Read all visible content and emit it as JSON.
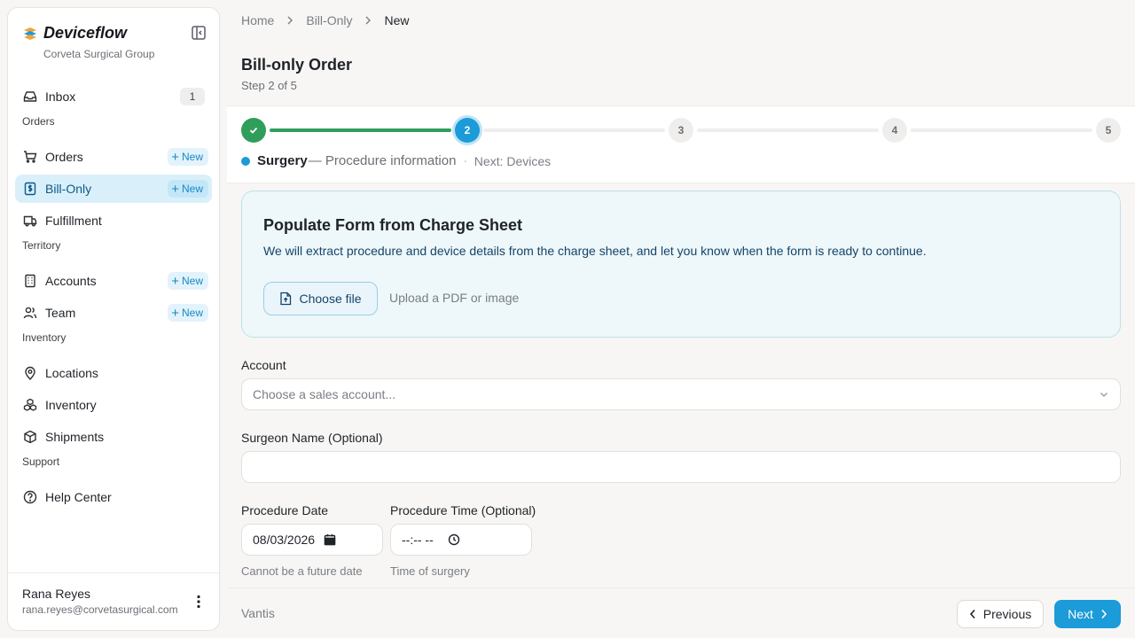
{
  "app": {
    "name": "Deviceflow",
    "org": "Corveta Surgical Group"
  },
  "sidebar": {
    "inbox": {
      "label": "Inbox",
      "badge": "1",
      "icon": "inbox-icon"
    },
    "sections": {
      "orders": "Orders",
      "territory": "Territory",
      "inventory": "Inventory",
      "support": "Support"
    },
    "new_label": "New",
    "items": {
      "orders": {
        "label": "Orders",
        "icon": "cart-icon"
      },
      "bill_only": {
        "label": "Bill-Only",
        "icon": "receipt-icon",
        "active": true
      },
      "fulfillment": {
        "label": "Fulfillment",
        "icon": "truck-icon"
      },
      "accounts": {
        "label": "Accounts",
        "icon": "building-icon"
      },
      "team": {
        "label": "Team",
        "icon": "users-icon"
      },
      "locations": {
        "label": "Locations",
        "icon": "map-pin-icon"
      },
      "inventory": {
        "label": "Inventory",
        "icon": "boxes-icon"
      },
      "shipments": {
        "label": "Shipments",
        "icon": "package-icon"
      },
      "help_center": {
        "label": "Help Center",
        "icon": "help-circle-icon"
      }
    },
    "user": {
      "name": "Rana Reyes",
      "email": "rana.reyes@corvetasurgical.com"
    }
  },
  "breadcrumb": {
    "home": "Home",
    "bill_only": "Bill-Only",
    "current": "New"
  },
  "page": {
    "title": "Bill-only Order",
    "subtitle": "Step 2 of 5"
  },
  "stepper": {
    "total_steps": 5,
    "current_step": 2,
    "steps": [
      "1",
      "2",
      "3",
      "4",
      "5"
    ],
    "current_name": "Surgery",
    "current_desc": "— Procedure information",
    "separator": "·",
    "next_text": "Next: Devices",
    "colors": {
      "done": "#2f9e5b",
      "current": "#1b9bd8",
      "pending": "#efeeec"
    }
  },
  "upload": {
    "title": "Populate Form from Charge Sheet",
    "description": "We will extract procedure and device details from the charge sheet, and let you know when the form is ready to continue.",
    "button_label": "Choose file",
    "hint": "Upload a PDF or image"
  },
  "form": {
    "account": {
      "label": "Account",
      "placeholder": "Choose a sales account..."
    },
    "surgeon": {
      "label": "Surgeon Name (Optional)",
      "value": ""
    },
    "procedure_date": {
      "label": "Procedure Date",
      "value": "08/03/2026",
      "help": "Cannot be a future date"
    },
    "procedure_time": {
      "label": "Procedure Time (Optional)",
      "value": "--:-- --",
      "help": "Time of surgery"
    }
  },
  "footer": {
    "brand": "Vantis",
    "previous_label": "Previous",
    "next_label": "Next"
  },
  "theme": {
    "accent": "#1b9bd8",
    "success": "#2f9e5b",
    "active_bg": "#d9f0fb"
  }
}
